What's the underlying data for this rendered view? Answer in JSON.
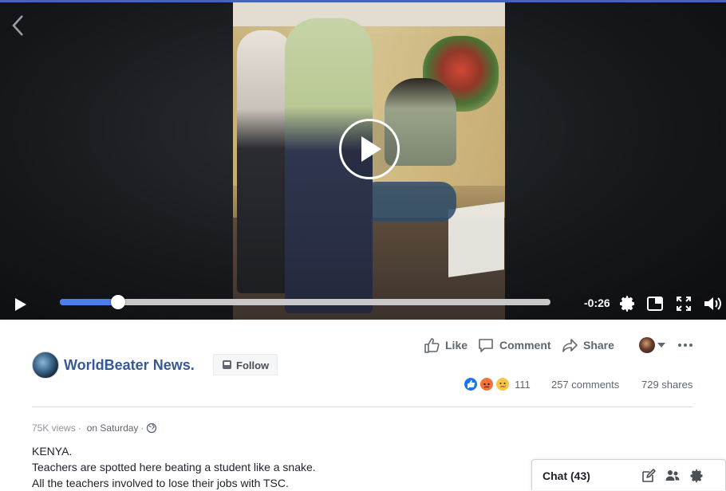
{
  "video": {
    "time_remaining": "-0:26",
    "progress": 0.118,
    "controls": {
      "play_icon": "play-icon",
      "settings_icon": "gear-icon",
      "pip_icon": "picture-in-picture-icon",
      "fullscreen_icon": "fullscreen-icon",
      "volume_icon": "volume-icon",
      "back_icon": "chevron-left-icon",
      "big_play_icon": "play-circle-icon"
    }
  },
  "post": {
    "page_name": "WorldBeater News.",
    "follow_label": "Follow",
    "actions": {
      "like": "Like",
      "comment": "Comment",
      "share": "Share"
    },
    "reaction_count": "111",
    "comments": "257 comments",
    "shares": "729 shares",
    "views": "75K views",
    "separator": "·",
    "date": "on Saturday",
    "text_lines": [
      "KENYA.",
      "Teachers are spotted here beating a student like a snake.",
      "All the teachers involved to lose their jobs with TSC."
    ]
  },
  "chat": {
    "label": "Chat (43)"
  },
  "colors": {
    "link": "#365899",
    "progress": "#4a7ff0",
    "topbar": "#4267b2"
  }
}
